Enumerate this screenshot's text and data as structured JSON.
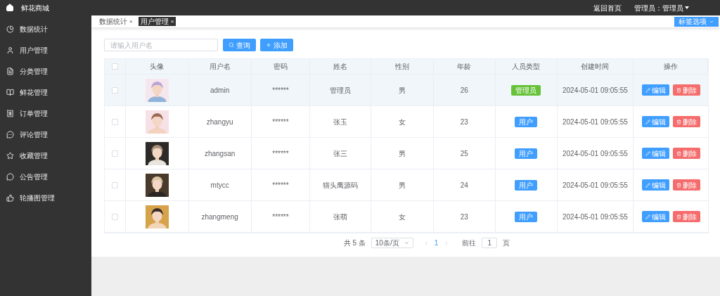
{
  "header": {
    "logo": "鲜花商城",
    "links": [
      "返回首页"
    ],
    "user_menu": "管理员：管理员"
  },
  "sidebar": {
    "items": [
      {
        "label": "数据统计"
      },
      {
        "label": "用户管理"
      },
      {
        "label": "分类管理"
      },
      {
        "label": "鲜花管理"
      },
      {
        "label": "订单管理"
      },
      {
        "label": "评论管理"
      },
      {
        "label": "收藏管理"
      },
      {
        "label": "公告管理"
      },
      {
        "label": "轮播图管理"
      }
    ]
  },
  "tabs": [
    {
      "label": "数据统计",
      "close": "×",
      "selected": false
    },
    {
      "label": "用户管理",
      "close": "×",
      "selected": true
    }
  ],
  "tab_options": "标签选项",
  "toolbar": {
    "search": {
      "placeholder": "请输入用户名"
    },
    "query": "查询",
    "add": "添加"
  },
  "table": {
    "select_all_checked": false,
    "columns": [
      "头像",
      "用户名",
      "密码",
      "姓名",
      "性别",
      "年龄",
      "人员类型",
      "创建时间",
      "操作"
    ],
    "rows": [
      {
        "highlighted": true,
        "checked": false,
        "username": "admin",
        "password": "******",
        "name": "管理员",
        "gender": "男",
        "age": "26",
        "role": {
          "label": "管理员",
          "kind": "admin"
        },
        "created": "2024-05-01 09:05:55",
        "edit": "编辑",
        "delete": "删除"
      },
      {
        "highlighted": false,
        "checked": false,
        "username": "zhangyu",
        "password": "******",
        "name": "张玉",
        "gender": "女",
        "age": "23",
        "role": {
          "label": "用户",
          "kind": "user"
        },
        "created": "2024-05-01 09:05:55",
        "edit": "编辑",
        "delete": "删除"
      },
      {
        "highlighted": false,
        "checked": false,
        "username": "zhangsan",
        "password": "******",
        "name": "张三",
        "gender": "男",
        "age": "25",
        "role": {
          "label": "用户",
          "kind": "user"
        },
        "created": "2024-05-01 09:05:55",
        "edit": "编辑",
        "delete": "删除"
      },
      {
        "highlighted": false,
        "checked": false,
        "username": "mtycc",
        "password": "******",
        "name": "猫头鹰源码",
        "gender": "男",
        "age": "24",
        "role": {
          "label": "用户",
          "kind": "user"
        },
        "created": "2024-05-01 09:05:55",
        "edit": "编辑",
        "delete": "删除"
      },
      {
        "highlighted": false,
        "checked": false,
        "username": "zhangmeng",
        "password": "******",
        "name": "张萌",
        "gender": "女",
        "age": "23",
        "role": {
          "label": "用户",
          "kind": "user"
        },
        "created": "2024-05-01 09:05:55",
        "edit": "编辑",
        "delete": "删除"
      }
    ]
  },
  "pagination": {
    "total": "共 5 条",
    "page_size": "10条/页",
    "pages": [
      {
        "label": "1",
        "selected": true
      }
    ],
    "goto_label": "前往",
    "goto_value": "1",
    "goto_unit": "页"
  }
}
